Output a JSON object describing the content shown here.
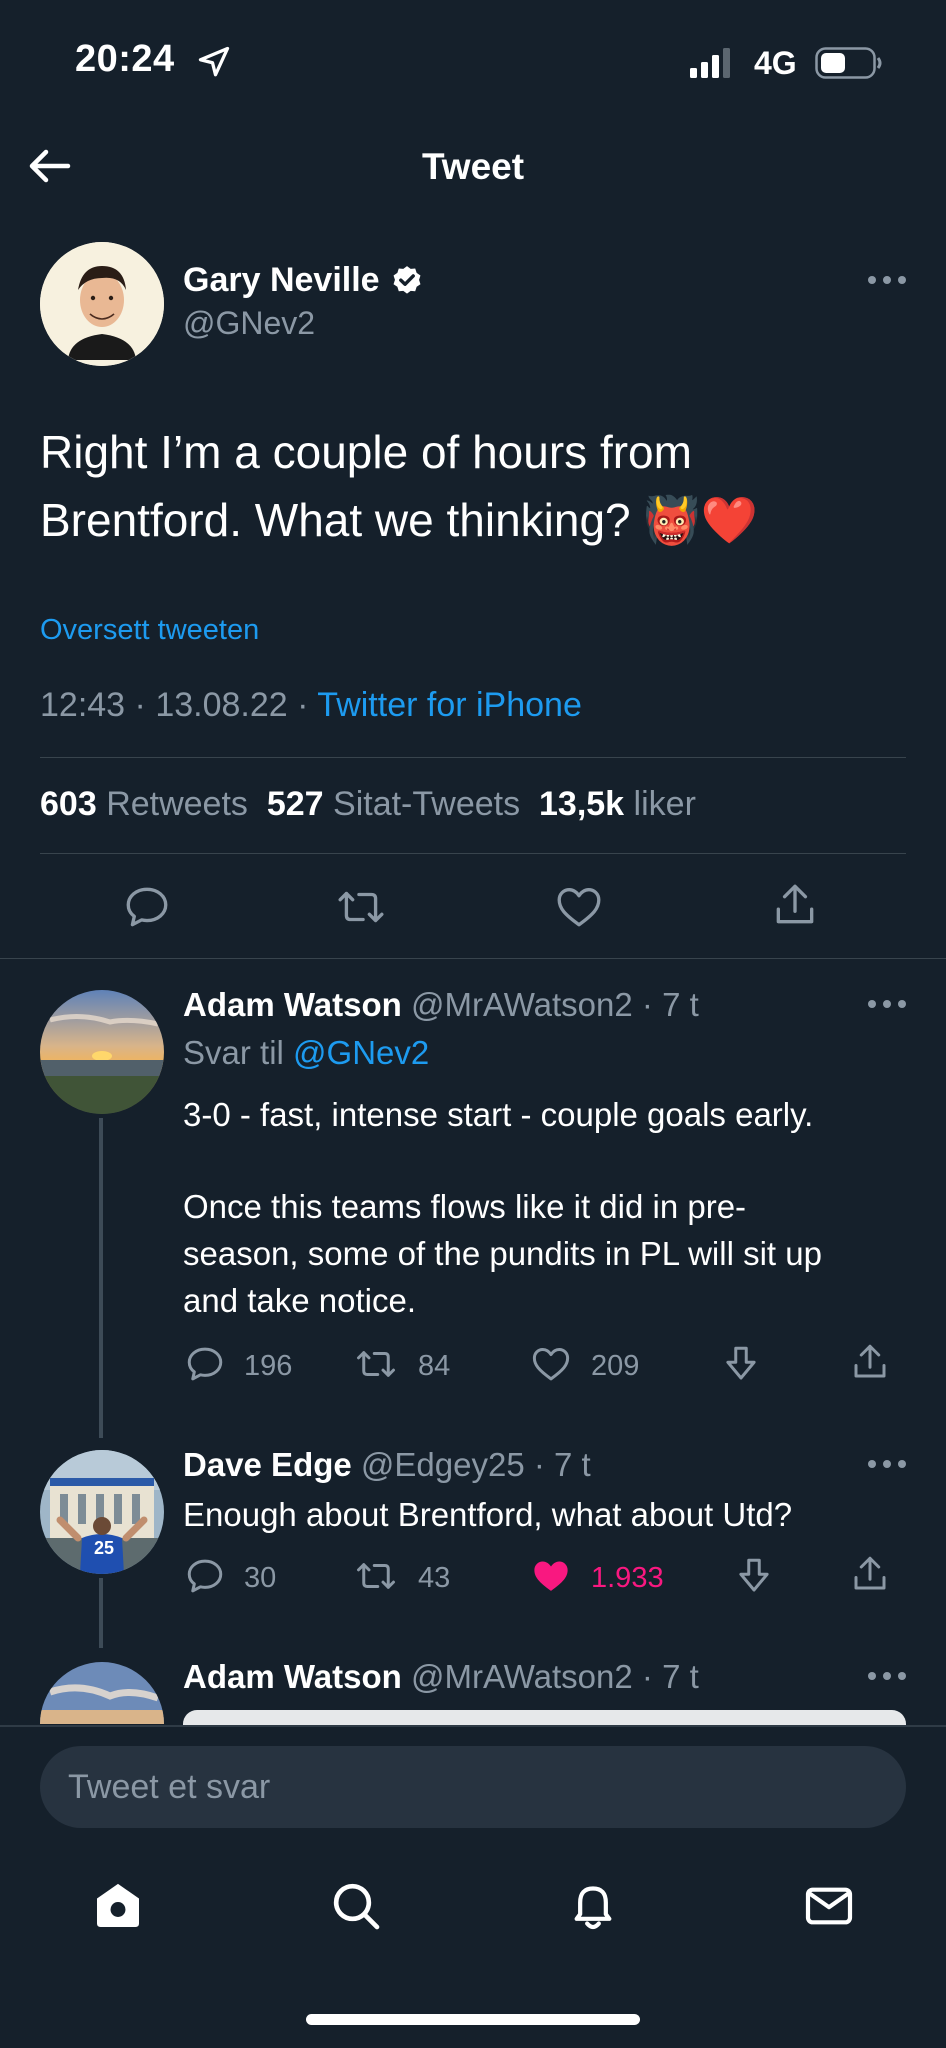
{
  "status_bar": {
    "time": "20:24",
    "network": "4G",
    "location_icon": "location-arrow-icon",
    "signal_icon": "signal-bars-icon",
    "battery_icon": "battery-icon"
  },
  "header": {
    "title": "Tweet",
    "back_icon": "arrow-left-icon"
  },
  "tweet": {
    "author_name": "Gary Neville",
    "author_handle": "@GNev2",
    "verified_icon": "verified-badge-icon",
    "text_line1": "Right I’m a couple of hours from",
    "text_line2": "Brentford. What we thinking? 👹❤️",
    "translate_label": "Oversett tweeten",
    "time": "12:43",
    "date": "13.08.22",
    "source": "Twitter for iPhone",
    "stats": {
      "retweets_count": "603",
      "retweets_label": "Retweets",
      "quotes_count": "527",
      "quotes_label": "Sitat-Tweets",
      "likes_count": "13,5k",
      "likes_label": "liker"
    }
  },
  "replies": [
    {
      "name": "Adam Watson",
      "handle": "@MrAWatson2",
      "age": "7 t",
      "reply_to_label": "Svar til",
      "reply_to_handle": "@GNev2",
      "text_line1": "3-0  - fast, intense start - couple goals early.",
      "text_line2": "Once this teams flows like it did in pre-",
      "text_line3": "season, some of the pundits in PL will sit up",
      "text_line4": "and take notice.",
      "replies": "196",
      "retweets": "84",
      "likes": "209"
    },
    {
      "name": "Dave Edge",
      "handle": "@Edgey25",
      "age": "7 t",
      "text_line1": "Enough about Brentford, what about Utd?",
      "replies": "30",
      "retweets": "43",
      "likes": "1.933",
      "liked": true,
      "jersey_number": "25"
    },
    {
      "name": "Adam Watson",
      "handle": "@MrAWatson2",
      "age": "7 t"
    }
  ],
  "composer": {
    "placeholder": "Tweet et svar"
  },
  "colors": {
    "background": "#15202b",
    "accent": "#1d9bf0",
    "like_pink": "#f91880",
    "muted": "#8b98a5"
  }
}
